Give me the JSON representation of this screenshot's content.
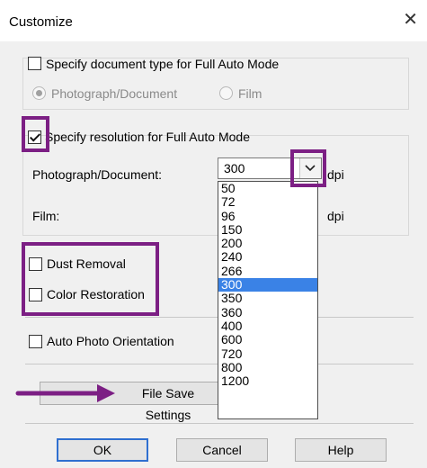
{
  "window": {
    "title": "Customize",
    "close_glyph": "✕"
  },
  "doc_type": {
    "checkbox_label": "Specify document type for Full Auto Mode",
    "checked": false,
    "radio_photo_label": "Photograph/Document",
    "radio_film_label": "Film",
    "selected": "Photograph/Document"
  },
  "resolution": {
    "checkbox_label": "Specify resolution for Full Auto Mode",
    "checked": true,
    "photo_label": "Photograph/Document:",
    "photo_value": "300",
    "film_label": "Film:",
    "unit_photo": "dpi",
    "unit_film": "dpi",
    "options": [
      "50",
      "72",
      "96",
      "150",
      "200",
      "240",
      "266",
      "300",
      "350",
      "360",
      "400",
      "600",
      "720",
      "800",
      "1200"
    ],
    "selected_option": "300"
  },
  "options": {
    "dust_removal_label": "Dust Removal",
    "color_restoration_label": "Color Restoration",
    "auto_orientation_label": "Auto Photo Orientation"
  },
  "file_save": {
    "button_label": "File Save Settings"
  },
  "buttons": {
    "ok": "OK",
    "cancel": "Cancel",
    "help": "Help"
  },
  "colors": {
    "highlight": "#7c1f84",
    "selection": "#3a82e6"
  },
  "icons": {
    "close": "close-icon",
    "combo_arrow": "chevron-down-icon",
    "annotation_arrow": "arrow-right-icon"
  }
}
